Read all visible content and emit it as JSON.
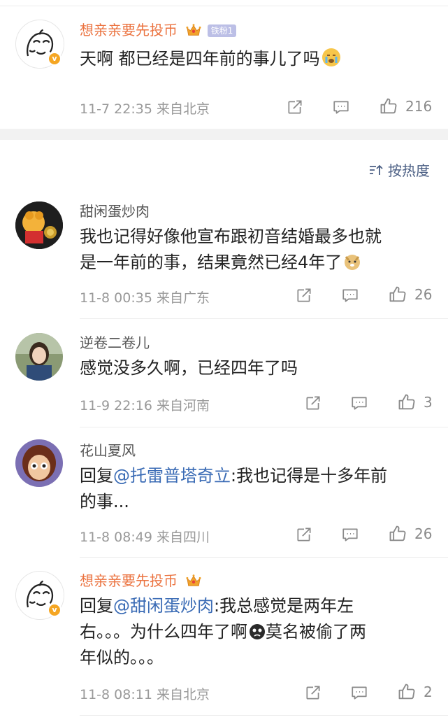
{
  "comments": [
    {
      "name": "想亲亲要先投币",
      "fan_badge": "铁粉1",
      "text": "天啊 都已经是四年前的事儿了吗",
      "time": "11-7 22:35",
      "location": "来自北京",
      "likes": "216"
    },
    {
      "name": "甜闲蛋炒肉",
      "text_line1": "我也记得好像他宣布跟初音结婚最多也就",
      "text_line2": "是一年前的事，结果竟然已经4年了",
      "time": "11-8 00:35",
      "location": "来自广东",
      "likes": "26"
    },
    {
      "name": "逆卷二卷儿",
      "text": "感觉没多久啊，已经四年了吗",
      "time": "11-9 22:16",
      "location": "来自河南",
      "likes": "3"
    },
    {
      "name": "花山夏风",
      "reply_prefix": "回复",
      "mention": "@托雷普塔奇立",
      "text_part1": ":我也记得是十多年前",
      "text_line2": "的事...",
      "time": "11-8 08:49",
      "location": "来自四川",
      "likes": "26"
    },
    {
      "name": "想亲亲要先投币",
      "reply_prefix": "回复",
      "mention": "@甜闲蛋炒肉",
      "text_part1": ":我总感觉是两年左",
      "text_line2a": "右。。。为什么四年了啊",
      "text_line2b": "莫名被偷了两",
      "text_line3": "年似的。。。",
      "time": "11-8 08:11",
      "location": "来自北京",
      "likes": "2"
    }
  ],
  "sort_label": "按热度",
  "icons": [
    "repost-icon",
    "comment-icon",
    "like-icon",
    "crown-icon",
    "sort-icon"
  ],
  "colors": {
    "vip_name": "#eb7340",
    "mention": "#3a6bb5",
    "meta": "#999999"
  }
}
